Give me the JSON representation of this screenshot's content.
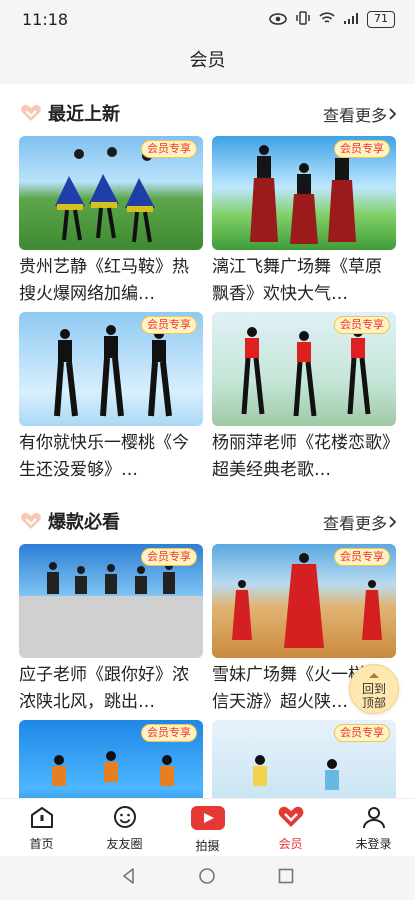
{
  "status": {
    "time": "11:18",
    "battery": "71"
  },
  "header": {
    "title": "会员"
  },
  "sections": [
    {
      "title": "最近上新",
      "more": "查看更多",
      "cards": [
        {
          "title": "贵州艺静《红马鞍》热搜火爆网络加编…",
          "badge": "会员专享"
        },
        {
          "title": "漓江飞舞广场舞《草原飘香》欢快大气…",
          "badge": "会员专享"
        },
        {
          "title": "有你就快乐一樱桃《今生还没爱够》…",
          "badge": "会员专享"
        },
        {
          "title": "杨丽萍老师《花楼恋歌》超美经典老歌…",
          "badge": "会员专享"
        }
      ]
    },
    {
      "title": "爆款必看",
      "more": "查看更多",
      "cards": [
        {
          "title": "应子老师《跟你好》浓浓陕北风，跳出…",
          "badge": "会员专享"
        },
        {
          "title": "雪妹广场舞《火一样的信天游》超火陕…",
          "badge": "会员专享"
        },
        {
          "title": "",
          "badge": "会员专享"
        },
        {
          "title": "",
          "badge": "会员专享"
        }
      ]
    }
  ],
  "back_to_top": {
    "line1": "回到",
    "line2": "顶部"
  },
  "tabs": [
    {
      "label": "首页",
      "icon": "home-icon"
    },
    {
      "label": "友友圈",
      "icon": "smile-icon"
    },
    {
      "label": "拍摄",
      "icon": "camera-icon"
    },
    {
      "label": "会员",
      "icon": "vip-heart-icon",
      "active": true
    },
    {
      "label": "未登录",
      "icon": "user-icon"
    }
  ],
  "colors": {
    "accent": "#e53935",
    "badge_bg": "#fff3c4"
  }
}
